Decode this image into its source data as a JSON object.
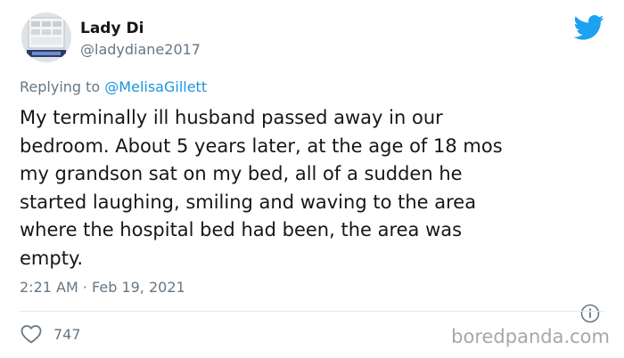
{
  "author": {
    "display_name": "Lady Di",
    "handle": "@ladydiane2017",
    "avatar_icon": "avatar-image"
  },
  "reply": {
    "prefix": "Replying to",
    "mention": "@MelisaGillett"
  },
  "tweet": {
    "text": "My terminally ill husband passed away in our\nbedroom. About 5 years later, at the age of 18 mos\nmy grandson sat on my bed, all of a sudden he\nstarted laughing, smiling and waving to the area\nwhere the hospital bed had been, the area was\nempty.",
    "timestamp": "2:21 AM · Feb 19, 2021"
  },
  "actions": {
    "like_count": "747"
  },
  "watermark": "boredpanda.com",
  "colors": {
    "twitter_blue": "#1da1f2",
    "link_blue": "#1b95e0",
    "muted_text": "#657786",
    "divider": "#e1e8ed"
  },
  "icons": {
    "brand": "twitter-bird-icon",
    "info": "info-icon",
    "like": "heart-icon"
  }
}
